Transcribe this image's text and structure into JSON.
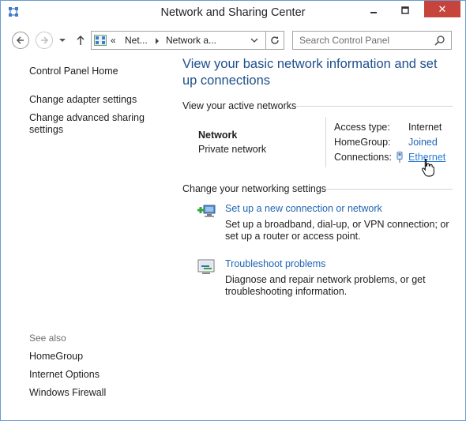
{
  "window": {
    "title": "Network and Sharing Center",
    "close_glyph": "✕"
  },
  "navbar": {
    "address_overflow": "«",
    "breadcrumb": [
      "Net...",
      "Network a..."
    ],
    "search_placeholder": "Search Control Panel"
  },
  "sidebar": {
    "control_panel_home": "Control Panel Home",
    "change_adapter": "Change adapter settings",
    "change_advanced_line1": "Change advanced sharing",
    "change_advanced_line2": "settings",
    "see_also": "See also",
    "see_also_items": [
      "HomeGroup",
      "Internet Options",
      "Windows Firewall"
    ]
  },
  "main": {
    "title": "View your basic network information and set up connections",
    "active_networks_label": "View your active networks",
    "network": {
      "name": "Network",
      "type": "Private network",
      "access_type_label": "Access type:",
      "access_type_value": "Internet",
      "homegroup_label": "HomeGroup:",
      "homegroup_value": "Joined",
      "connections_label": "Connections:",
      "connections_value": "Ethernet"
    },
    "change_settings_label": "Change your networking settings",
    "tasks": [
      {
        "link": "Set up a new connection or network",
        "desc": "Set up a broadband, dial-up, or VPN connection; or set up a router or access point.",
        "icon": "new-connection-icon"
      },
      {
        "link": "Troubleshoot problems",
        "desc": "Diagnose and repair network problems, or get troubleshooting information.",
        "icon": "troubleshoot-icon"
      }
    ]
  },
  "colors": {
    "title_blue": "#1e4f8c",
    "link_blue": "#1e64b4",
    "close_red": "#c7443c"
  }
}
